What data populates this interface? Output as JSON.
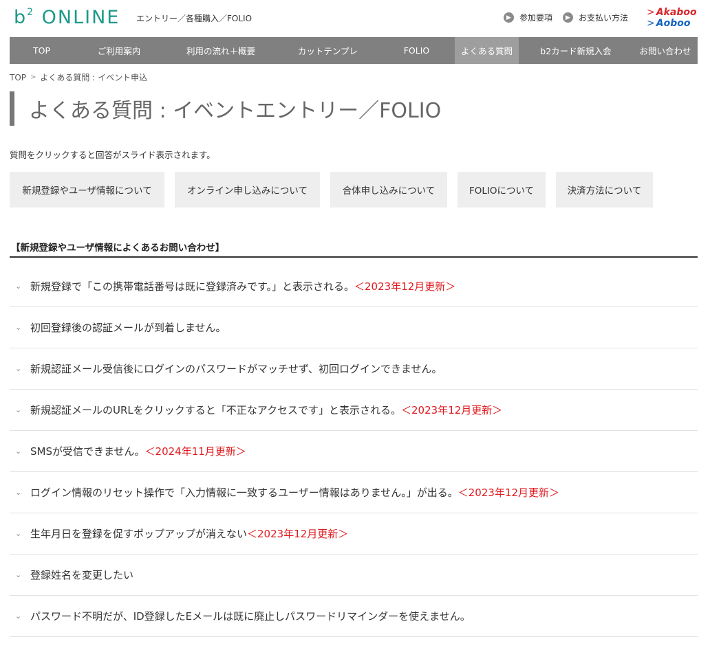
{
  "header": {
    "logo_main": "b",
    "logo_sup": "2",
    "logo_rest": " ONLINE",
    "subtitle": "エントリー／各種購入／FOLIO",
    "links": [
      {
        "label": "参加要項"
      },
      {
        "label": "お支払い方法"
      }
    ],
    "brand_a": "Akaboo",
    "brand_b": "Aoboo"
  },
  "nav": {
    "items": [
      {
        "label": "TOP"
      },
      {
        "label": "ご利用案内"
      },
      {
        "label": "利用の流れ＋概要"
      },
      {
        "label": "カットテンプレ"
      },
      {
        "label": "FOLIO"
      },
      {
        "label": "よくある質問"
      },
      {
        "label": "b2カード新規入会"
      },
      {
        "label": "お問い合わせ"
      }
    ]
  },
  "breadcrumb": {
    "home": "TOP",
    "current": "よくある質問 : イベント申込"
  },
  "page_title": "よくある質問 : イベントエントリー／FOLIO",
  "intro": "質問をクリックすると回答がスライド表示されます。",
  "categories": [
    {
      "label": "新規登録やユーザ情報について"
    },
    {
      "label": "オンライン申し込みについて"
    },
    {
      "label": "合体申し込みについて"
    },
    {
      "label": "FOLIOについて"
    },
    {
      "label": "決済方法について"
    }
  ],
  "section_title": "【新規登録やユーザ情報によくあるお問い合わせ】",
  "faq": [
    {
      "q": "新規登録で「この携帯電話番号は既に登録済みです。」と表示される。",
      "update": "＜2023年12月更新＞"
    },
    {
      "q": "初回登録後の認証メールが到着しません。",
      "update": ""
    },
    {
      "q": "新規認証メール受信後にログインのパスワードがマッチせず、初回ログインできません。",
      "update": ""
    },
    {
      "q": "新規認証メールのURLをクリックすると「不正なアクセスです」と表示される。",
      "update": "＜2023年12月更新＞"
    },
    {
      "q": "SMSが受信できません。",
      "update": "＜2024年11月更新＞"
    },
    {
      "q": "ログイン情報のリセット操作で「入力情報に一致するユーザー情報はありません。」が出る。",
      "update": "＜2023年12月更新＞"
    },
    {
      "q": "生年月日を登録を促すポップアップが消えない",
      "update": "＜2023年12月更新＞"
    },
    {
      "q": "登録姓名を変更したい",
      "update": ""
    },
    {
      "q": "パスワード不明だが、ID登録したEメールは既に廃止しパスワードリマインダーを使えません。",
      "update": ""
    }
  ],
  "colors": {
    "logo": "#1b9a8a",
    "nav_bg": "#808080",
    "nav_active": "#9e9e9e",
    "update_red": "#e0191e",
    "category_bg": "#eeeeee"
  },
  "icons": {
    "header_link": "chevron-right-circle-icon",
    "faq_toggle": "chevron-down-icon",
    "breadcrumb_sep": "chevron-right-icon"
  }
}
